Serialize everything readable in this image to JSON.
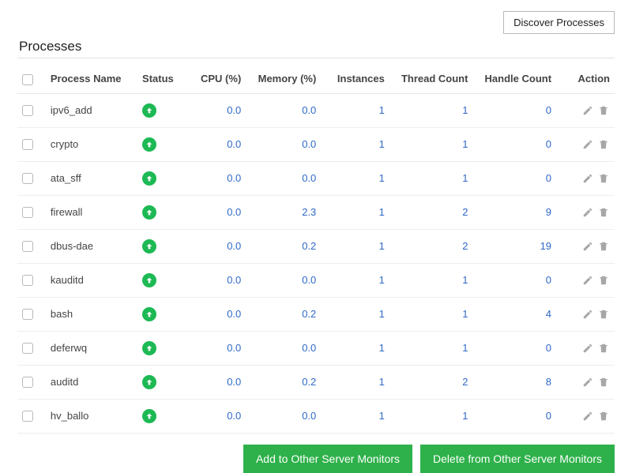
{
  "header": {
    "discover_button": "Discover Processes",
    "title": "Processes"
  },
  "columns": {
    "name": "Process Name",
    "status": "Status",
    "cpu": "CPU (%)",
    "memory": "Memory (%)",
    "instances": "Instances",
    "threads": "Thread Count",
    "handles": "Handle Count",
    "action": "Action"
  },
  "rows": [
    {
      "name": "ipv6_add",
      "cpu": "0.0",
      "memory": "0.0",
      "instances": "1",
      "threads": "1",
      "handles": "0"
    },
    {
      "name": "crypto",
      "cpu": "0.0",
      "memory": "0.0",
      "instances": "1",
      "threads": "1",
      "handles": "0"
    },
    {
      "name": "ata_sff",
      "cpu": "0.0",
      "memory": "0.0",
      "instances": "1",
      "threads": "1",
      "handles": "0"
    },
    {
      "name": "firewall",
      "cpu": "0.0",
      "memory": "2.3",
      "instances": "1",
      "threads": "2",
      "handles": "9"
    },
    {
      "name": "dbus-dae",
      "cpu": "0.0",
      "memory": "0.2",
      "instances": "1",
      "threads": "2",
      "handles": "19"
    },
    {
      "name": "kauditd",
      "cpu": "0.0",
      "memory": "0.0",
      "instances": "1",
      "threads": "1",
      "handles": "0"
    },
    {
      "name": "bash",
      "cpu": "0.0",
      "memory": "0.2",
      "instances": "1",
      "threads": "1",
      "handles": "4"
    },
    {
      "name": "deferwq",
      "cpu": "0.0",
      "memory": "0.0",
      "instances": "1",
      "threads": "1",
      "handles": "0"
    },
    {
      "name": "auditd",
      "cpu": "0.0",
      "memory": "0.2",
      "instances": "1",
      "threads": "2",
      "handles": "8"
    },
    {
      "name": "hv_ballo",
      "cpu": "0.0",
      "memory": "0.0",
      "instances": "1",
      "threads": "1",
      "handles": "0"
    }
  ],
  "footer": {
    "add_button": "Add to Other Server Monitors",
    "delete_button": "Delete from Other Server Monitors"
  }
}
